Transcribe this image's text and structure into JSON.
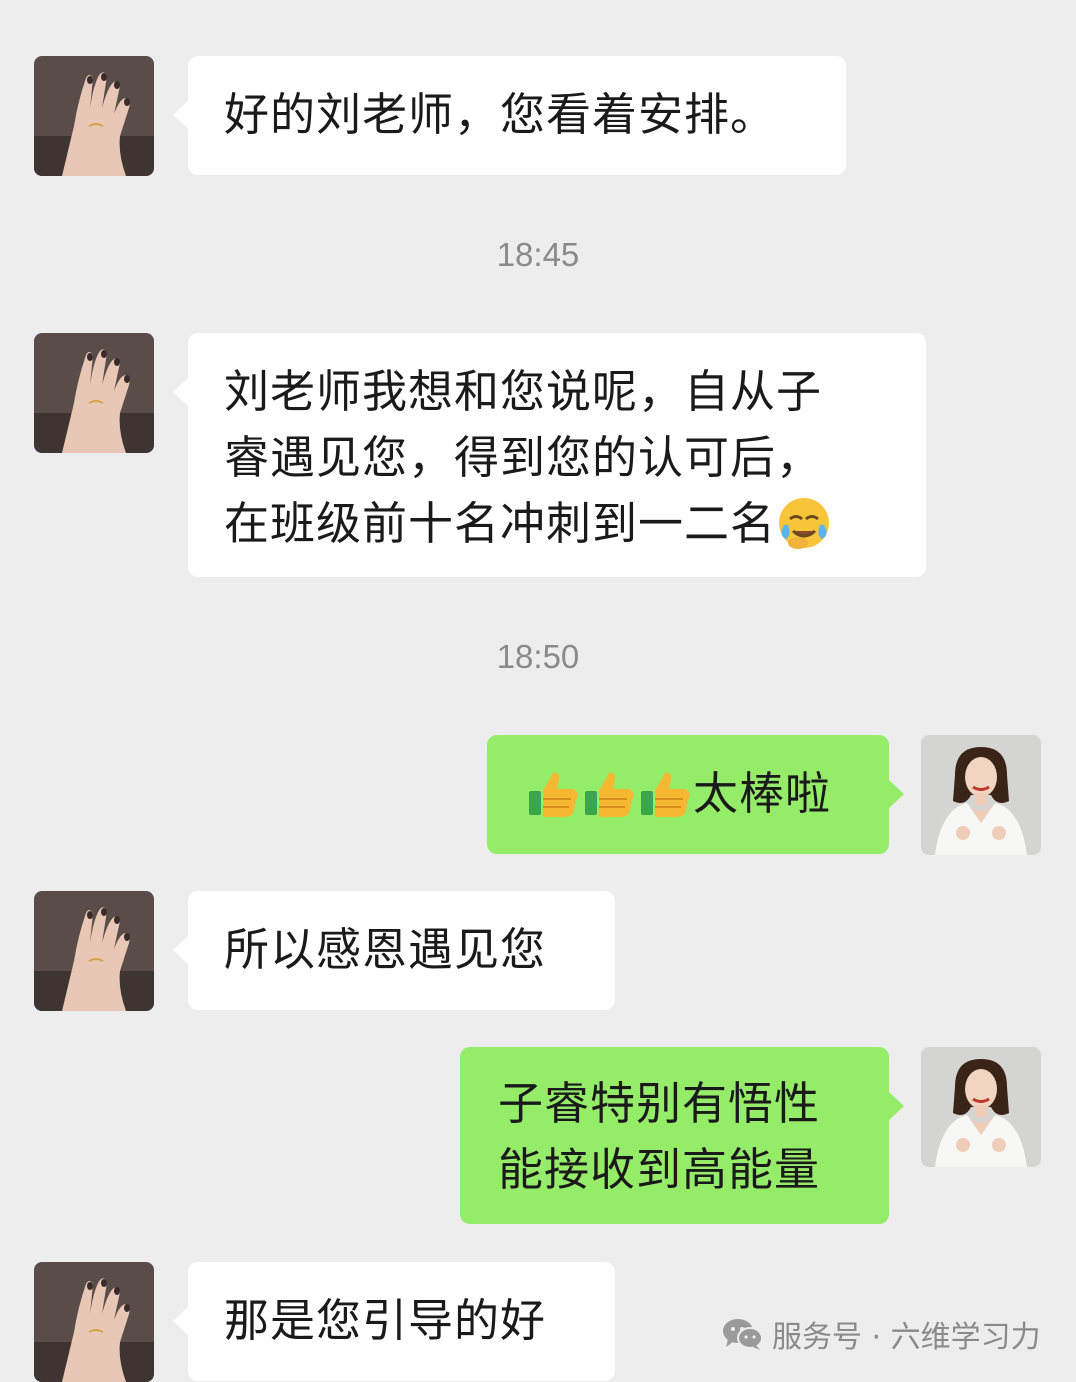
{
  "colors": {
    "background": "#ededed",
    "incoming_bubble": "#ffffff",
    "outgoing_bubble": "#95ec69",
    "timestamp_text": "#8a8a8a"
  },
  "messages": [
    {
      "side": "incoming",
      "lines": [
        "好的刘老师，您看着安排。"
      ]
    },
    {
      "time": "18:45"
    },
    {
      "side": "incoming",
      "lines": [
        "刘老师我想和您说呢，自从子",
        "睿遇见您，得到您的认可后，",
        "在班级前十名冲刺到一二名"
      ],
      "emoji": "face-with-tears-icon"
    },
    {
      "time": "18:50"
    },
    {
      "side": "outgoing",
      "emoji": "thumbs-up-icon",
      "text": "太棒啦"
    },
    {
      "side": "incoming",
      "lines": [
        "所以感恩遇见您"
      ]
    },
    {
      "side": "outgoing",
      "lines": [
        "子睿特别有悟性",
        "能接收到高能量"
      ]
    },
    {
      "side": "incoming",
      "lines": [
        "那是您引导的好"
      ]
    }
  ],
  "watermark": {
    "icon": "wechat-icon",
    "text": "服务号 · 六维学习力"
  }
}
